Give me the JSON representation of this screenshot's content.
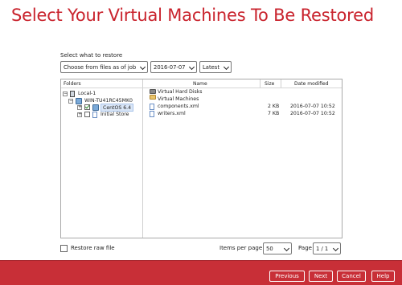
{
  "title": "Select Your Virtual Machines To Be Restored",
  "restore_label": "Select what to restore",
  "mode_select": "Choose from files as of job",
  "date_select": "2016-07-07",
  "time_select": "Latest",
  "columns": {
    "folders": "Folders",
    "name": "Name",
    "size": "Size",
    "date_modified": "Date modified"
  },
  "tree": {
    "root": "Local-1",
    "host": "WIN-TU41RC45MK0",
    "vm1": "CentOS 6.4",
    "vm2": "Initial Store"
  },
  "files": [
    {
      "name": "Virtual Hard Disks",
      "size": "",
      "date": "",
      "icon": "hard-disk-folder-icon"
    },
    {
      "name": "Virtual Machines",
      "size": "",
      "date": "",
      "icon": "folder-icon"
    },
    {
      "name": "components.xml",
      "size": "2 KB",
      "date": "2016-07-07 10:52",
      "icon": "xml-file-icon"
    },
    {
      "name": "writers.xml",
      "size": "7 KB",
      "date": "2016-07-07 10:52",
      "icon": "xml-file-icon"
    }
  ],
  "restore_raw_label": "Restore raw file",
  "items_per_page_label": "Items per page",
  "items_per_page_value": "50",
  "page_label": "Page",
  "page_value": "1 / 1",
  "buttons": {
    "previous": "Previous",
    "next": "Next",
    "cancel": "Cancel",
    "help": "Help"
  },
  "colors": {
    "accent": "#c9232d",
    "footer": "#c82f37"
  }
}
